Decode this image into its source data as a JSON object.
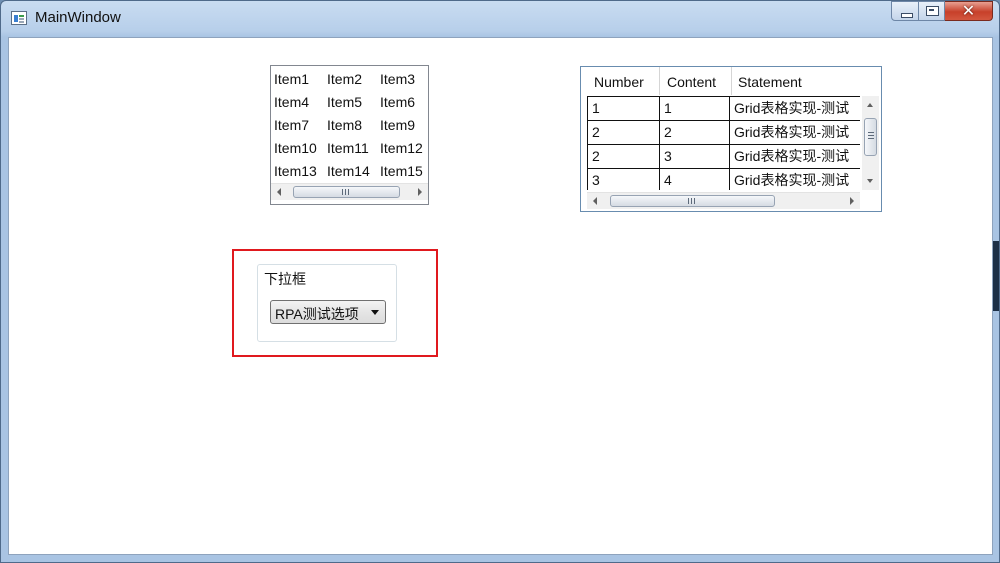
{
  "window": {
    "title": "MainWindow",
    "caption_buttons": {
      "minimize": "minimize",
      "maximize": "maximize",
      "close": "✕"
    }
  },
  "listbox": {
    "items": [
      "Item1",
      "Item2",
      "Item3",
      "Item4",
      "Item5",
      "Item6",
      "Item7",
      "Item8",
      "Item9",
      "Item10",
      "Item11",
      "Item12",
      "Item13",
      "Item14",
      "Item15"
    ],
    "scrollbar_grip": "|||"
  },
  "datagrid": {
    "columns": [
      "Number",
      "Content",
      "Statement"
    ],
    "rows": [
      [
        "1",
        "1",
        "Grid表格实现-测试"
      ],
      [
        "2",
        "2",
        "Grid表格实现-测试"
      ],
      [
        "2",
        "3",
        "Grid表格实现-测试"
      ],
      [
        "3",
        "4",
        "Grid表格实现-测试"
      ]
    ],
    "scrollbar_grip": "|||"
  },
  "groupbox": {
    "header": "下拉框",
    "combobox": {
      "selected": "RPA测试选项"
    }
  },
  "colors": {
    "highlight_border": "#e0191e",
    "close_button": "#c7402a"
  }
}
